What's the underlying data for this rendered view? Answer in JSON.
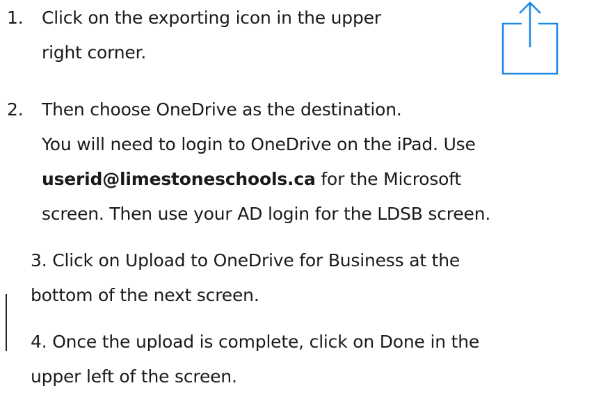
{
  "steps": [
    {
      "number": "1.",
      "lines": [
        "Click on the exporting icon in the upper",
        "right corner."
      ]
    },
    {
      "number": "2.",
      "lines": [
        "Then choose OneDrive as the destination.",
        "You will need to login to OneDrive on the iPad.  Use"
      ],
      "email": "userid@limestoneschools.ca",
      "after_email": " for the Microsoft",
      "last_line": "screen. Then use your AD login for the LDSB screen."
    },
    {
      "lines": [
        "3. Click on Upload to OneDrive for Business at the",
        "bottom of the next screen."
      ]
    },
    {
      "lines": [
        "4. Once the upload is complete, click on Done in the",
        "upper left of the screen."
      ]
    }
  ],
  "icons": {
    "export": "share-export-icon",
    "export_color": "#1e88e5"
  }
}
